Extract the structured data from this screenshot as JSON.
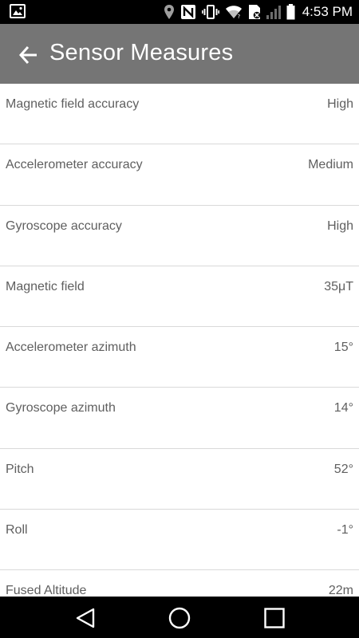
{
  "status_bar": {
    "time": "4:53 PM",
    "icons": [
      "image-icon",
      "location-icon",
      "nfc-icon",
      "vibrate-icon",
      "wifi-icon",
      "no-sim-icon",
      "signal-icon",
      "battery-icon"
    ]
  },
  "app_bar": {
    "title": "Sensor Measures",
    "back_icon": "arrow-back-icon"
  },
  "measures": [
    {
      "label": "Magnetic field accuracy",
      "value": "High"
    },
    {
      "label": "Accelerometer accuracy",
      "value": "Medium"
    },
    {
      "label": "Gyroscope accuracy",
      "value": "High"
    },
    {
      "label": "Magnetic field",
      "value": "35μT"
    },
    {
      "label": "Accelerometer azimuth",
      "value": "15°"
    },
    {
      "label": "Gyroscope azimuth",
      "value": "14°"
    },
    {
      "label": "Pitch",
      "value": "52°"
    },
    {
      "label": "Roll",
      "value": "-1°"
    },
    {
      "label": "Fused Altitude",
      "value": "22m"
    }
  ],
  "nav_bar": {
    "icons": [
      "nav-back-icon",
      "nav-home-icon",
      "nav-recent-icon"
    ]
  }
}
